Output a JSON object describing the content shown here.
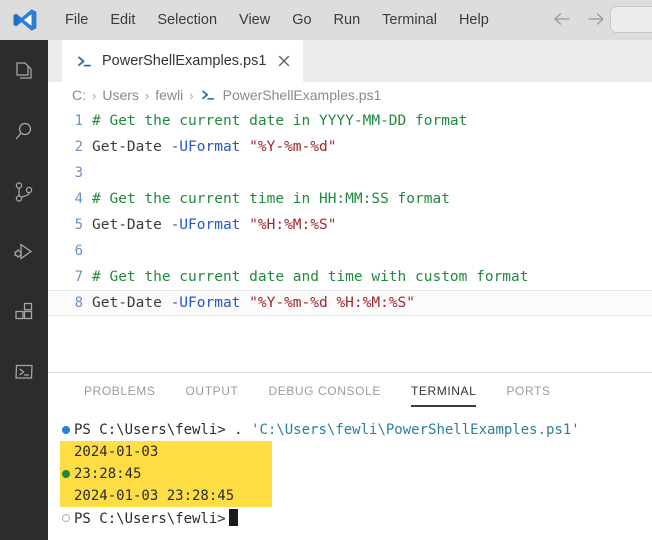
{
  "titlebar": {
    "logo_icon": "vscode-logo",
    "menu": [
      {
        "label": "File"
      },
      {
        "label": "Edit"
      },
      {
        "label": "Selection"
      },
      {
        "label": "View"
      },
      {
        "label": "Go"
      },
      {
        "label": "Run"
      },
      {
        "label": "Terminal"
      },
      {
        "label": "Help"
      }
    ],
    "back_icon": "arrow-left-icon",
    "forward_icon": "arrow-right-icon",
    "search_placeholder": ""
  },
  "activitybar": {
    "items": [
      {
        "name": "explorer",
        "icon": "files-icon"
      },
      {
        "name": "search",
        "icon": "search-icon"
      },
      {
        "name": "source-control",
        "icon": "source-control-icon"
      },
      {
        "name": "run-debug",
        "icon": "run-and-debug-icon"
      },
      {
        "name": "extensions",
        "icon": "extensions-icon"
      },
      {
        "name": "terminal",
        "icon": "terminal-icon"
      }
    ]
  },
  "editor": {
    "tab": {
      "label": "PowerShellExamples.ps1",
      "icon": "powershell-icon",
      "close_icon": "close-icon"
    },
    "breadcrumb": {
      "items": [
        "C:",
        "Users",
        "fewli",
        "PowerShellExamples.ps1"
      ],
      "separator": "›",
      "file_icon": "powershell-icon"
    },
    "active_line": 8,
    "lines": [
      {
        "num": "1",
        "tokens": [
          {
            "t": "comment",
            "v": "# Get the current date in YYYY-MM-DD format"
          }
        ]
      },
      {
        "num": "2",
        "tokens": [
          {
            "t": "cmd",
            "v": "Get-Date "
          },
          {
            "t": "param",
            "v": "-UFormat "
          },
          {
            "t": "string",
            "v": "\"%Y-%m-%d\""
          }
        ]
      },
      {
        "num": "3",
        "tokens": [
          {
            "t": "cmd",
            "v": ""
          }
        ]
      },
      {
        "num": "4",
        "tokens": [
          {
            "t": "comment",
            "v": "# Get the current time in HH:MM:SS format"
          }
        ]
      },
      {
        "num": "5",
        "tokens": [
          {
            "t": "cmd",
            "v": "Get-Date "
          },
          {
            "t": "param",
            "v": "-UFormat "
          },
          {
            "t": "string",
            "v": "\"%H:%M:%S\""
          }
        ]
      },
      {
        "num": "6",
        "tokens": [
          {
            "t": "cmd",
            "v": ""
          }
        ]
      },
      {
        "num": "7",
        "tokens": [
          {
            "t": "comment",
            "v": "# Get the current date and time with custom format"
          }
        ]
      },
      {
        "num": "8",
        "tokens": [
          {
            "t": "cmd",
            "v": "Get-Date "
          },
          {
            "t": "param",
            "v": "-UFormat "
          },
          {
            "t": "string",
            "v": "\"%Y-%m-%d %H:%M:%S\""
          }
        ]
      }
    ]
  },
  "panel": {
    "tabs": [
      {
        "label": "PROBLEMS",
        "active": false
      },
      {
        "label": "OUTPUT",
        "active": false
      },
      {
        "label": "DEBUG CONSOLE",
        "active": false
      },
      {
        "label": "TERMINAL",
        "active": true
      },
      {
        "label": "PORTS",
        "active": false
      }
    ],
    "terminal": {
      "lines": [
        {
          "decoration": "blue-dot",
          "prompt": "PS C:\\Users\\fewli> ",
          "command": ". ",
          "path": "'C:\\Users\\fewli\\PowerShellExamples.ps1'",
          "highlighted": false
        },
        {
          "decoration": "none",
          "output": "2024-01-03",
          "highlighted": true
        },
        {
          "decoration": "green-dot",
          "output": "23:28:45",
          "highlighted": true
        },
        {
          "decoration": "none",
          "output": "2024-01-03 23:28:45",
          "highlighted": true
        },
        {
          "decoration": "hollow-dot",
          "prompt": "PS C:\\Users\\fewli>",
          "cursor": true,
          "highlighted": false
        }
      ]
    }
  },
  "colors": {
    "accent_blue": "#2a7fd4",
    "comment_green": "#1f8a3e",
    "string_red": "#a4262c",
    "param_blue": "#2a56c6",
    "highlight_yellow": "#ffdd44",
    "activitybar_bg": "#2c2c2c",
    "titlebar_bg": "#dddddd"
  }
}
